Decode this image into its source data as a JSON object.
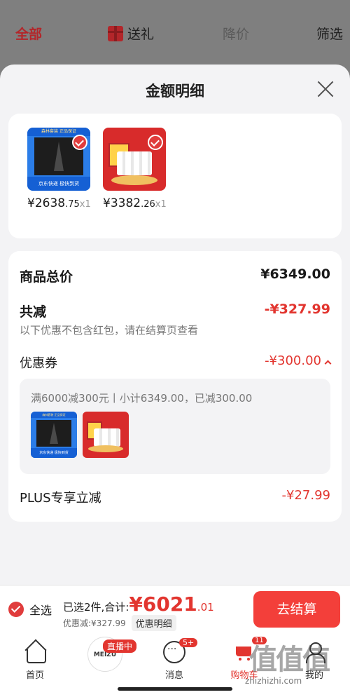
{
  "top_tabs": {
    "all": "全部",
    "gift": "送礼",
    "price_drop": "降价",
    "filter": "筛选"
  },
  "sheet": {
    "title": "金额明细",
    "products": [
      {
        "price_int": "¥2638",
        "price_dec": ".75",
        "qty": "x1",
        "img_top": "森林套装 正品保证",
        "img_bottom": "京东快递 极快到货"
      },
      {
        "price_int": "¥3382",
        "price_dec": ".26",
        "qty": "x1"
      }
    ],
    "summary": {
      "total_label": "商品总价",
      "total_value": "¥6349.00",
      "reduce_label": "共减",
      "reduce_value": "-¥327.99",
      "reduce_note": "以下优惠不包含红包，请在结算页查看",
      "coupon_label": "优惠券",
      "coupon_value": "-¥300.00",
      "coupon_desc": "满6000减300元丨小计6349.00，已减300.00",
      "plus_label": "PLUS专享立减",
      "plus_value": "-¥27.99"
    }
  },
  "checkout": {
    "select_all": "全选",
    "selected_text": "已选2件,合计:",
    "total_int": "¥6021",
    "total_dec": ".01",
    "discount_text": "优惠减:¥327.99",
    "detail_btn": "优惠明细",
    "checkout_btn": "去结算"
  },
  "tabbar": {
    "home": "首页",
    "live_badge": "直播中",
    "live_brand": "MEIZU",
    "messages": "消息",
    "messages_badge": "5+",
    "cart": "购物车",
    "cart_badge": "11",
    "me": "我的"
  },
  "watermark": {
    "text": "值值值",
    "url": "zhizhizhi.com"
  },
  "colors": {
    "accent_red": "#e2352f",
    "checkout_btn": "#f33f3a",
    "overlay_gray": "#7f7f7f"
  },
  "icons": [
    "gift-icon",
    "close-icon",
    "check-icon",
    "chevron-up-icon",
    "home-icon",
    "message-icon",
    "cart-icon",
    "user-icon"
  ]
}
